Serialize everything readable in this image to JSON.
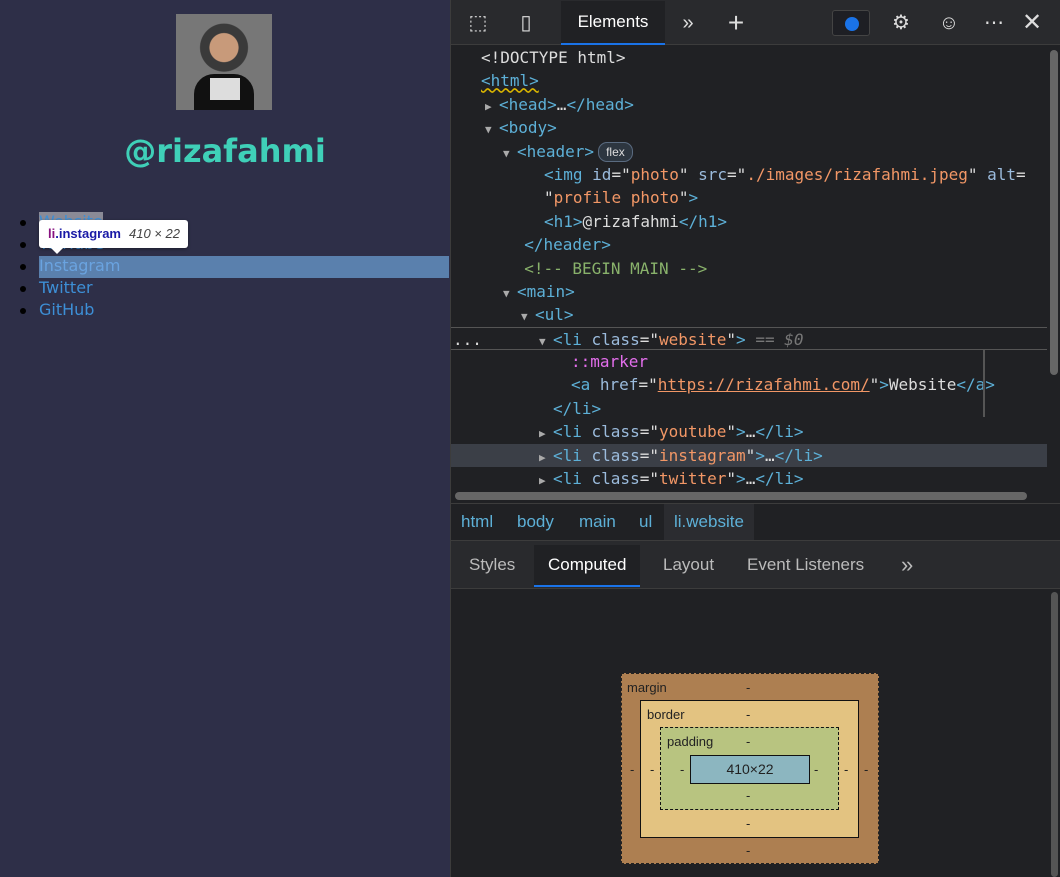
{
  "page": {
    "handle": "@rizafahmi",
    "links": [
      "Website",
      "YouTube",
      "Instagram",
      "Twitter",
      "GitHub"
    ],
    "tooltip": {
      "tag": "li",
      "cls": ".instagram",
      "size": "410 × 22"
    }
  },
  "devtools": {
    "toolbar": {
      "active_tab": "Elements",
      "icons": [
        "inspect-icon",
        "device-icon",
        "more-tabs-icon",
        "add-tab-icon",
        "issues-icon",
        "settings-icon",
        "feedback-icon",
        "more-icon",
        "close-icon"
      ]
    },
    "code": [
      {
        "d": 0,
        "t": [
          [
            "<!DOCTYPE html>",
            "txt"
          ]
        ]
      },
      {
        "d": 0,
        "t": [
          [
            "<html>",
            "tag"
          ]
        ]
      },
      {
        "d": 1,
        "a": "r",
        "t": [
          [
            "<head>",
            "tag"
          ],
          [
            "…",
            "txt"
          ],
          [
            "</head>",
            "tag"
          ]
        ]
      },
      {
        "d": 1,
        "a": "d",
        "t": [
          [
            "<body>",
            "tag"
          ]
        ]
      },
      {
        "d": 2,
        "a": "d",
        "t": [
          [
            "<header>",
            "tag"
          ]
        ],
        "badge": "flex"
      },
      {
        "d": 3.5,
        "t": [
          [
            "<img ",
            "tag"
          ],
          [
            "id",
            "attr"
          ],
          [
            "=\"",
            "txt"
          ],
          [
            "photo",
            "val"
          ],
          [
            "\" ",
            "txt"
          ],
          [
            "src",
            "attr"
          ],
          [
            "=\"",
            "txt"
          ],
          [
            "./images/rizafahmi.jpeg",
            "val"
          ],
          [
            "\" ",
            "txt"
          ],
          [
            "alt",
            "attr"
          ],
          [
            "=",
            "txt"
          ]
        ]
      },
      {
        "d": 3.5,
        "t": [
          [
            "\"",
            "txt"
          ],
          [
            "profile photo",
            "val"
          ],
          [
            "\"",
            "txt"
          ],
          [
            ">",
            "tag"
          ]
        ]
      },
      {
        "d": 3.5,
        "t": [
          [
            "<h1>",
            "tag"
          ],
          [
            "@rizafahmi",
            "txt"
          ],
          [
            "</h1>",
            "tag"
          ]
        ]
      },
      {
        "d": 2.4,
        "t": [
          [
            "</header>",
            "tag"
          ]
        ]
      },
      {
        "d": 2.4,
        "t": [
          [
            "<!-- BEGIN MAIN -->",
            "cm"
          ]
        ]
      },
      {
        "d": 2,
        "a": "d",
        "t": [
          [
            "<main>",
            "tag"
          ]
        ]
      },
      {
        "d": 3,
        "a": "d",
        "t": [
          [
            "<ul>",
            "tag"
          ]
        ]
      },
      {
        "d": 4,
        "a": "d",
        "sel": true,
        "t": [
          [
            "<li ",
            "tag"
          ],
          [
            "class",
            "attr"
          ],
          [
            "=\"",
            "txt"
          ],
          [
            "website",
            "val"
          ],
          [
            "\"",
            "txt"
          ],
          [
            ">",
            "tag"
          ],
          [
            " == ",
            "dim"
          ],
          [
            "$0",
            "dim"
          ]
        ]
      },
      {
        "d": 5,
        "t": [
          [
            "::marker",
            "ps"
          ]
        ]
      },
      {
        "d": 5,
        "t": [
          [
            "<a ",
            "tag"
          ],
          [
            "href",
            "attr"
          ],
          [
            "=\"",
            "txt"
          ],
          [
            "https://rizafahmi.com/",
            "lnk"
          ],
          [
            "\"",
            "txt"
          ],
          [
            ">",
            "tag"
          ],
          [
            "Website",
            "txt"
          ],
          [
            "</a>",
            "tag"
          ]
        ]
      },
      {
        "d": 4.0,
        "t": [
          [
            "</li>",
            "tag"
          ]
        ]
      },
      {
        "d": 4,
        "a": "r",
        "t": [
          [
            "<li ",
            "tag"
          ],
          [
            "class",
            "attr"
          ],
          [
            "=\"",
            "txt"
          ],
          [
            "youtube",
            "val"
          ],
          [
            "\"",
            "txt"
          ],
          [
            ">",
            "tag"
          ],
          [
            "…",
            "txt"
          ],
          [
            "</li>",
            "tag"
          ]
        ]
      },
      {
        "d": 4,
        "a": "r",
        "hov": true,
        "t": [
          [
            "<li ",
            "tag"
          ],
          [
            "class",
            "attr"
          ],
          [
            "=\"",
            "txt"
          ],
          [
            "instagram",
            "val"
          ],
          [
            "\"",
            "txt"
          ],
          [
            ">",
            "tag"
          ],
          [
            "…",
            "txt"
          ],
          [
            "</li>",
            "tag"
          ]
        ]
      },
      {
        "d": 4,
        "a": "r",
        "t": [
          [
            "<li ",
            "tag"
          ],
          [
            "class",
            "attr"
          ],
          [
            "=\"",
            "txt"
          ],
          [
            "twitter",
            "val"
          ],
          [
            "\"",
            "txt"
          ],
          [
            ">",
            "tag"
          ],
          [
            "…",
            "txt"
          ],
          [
            "</li>",
            "tag"
          ]
        ]
      }
    ],
    "ellipsis": "...",
    "breadcrumbs": [
      "html",
      "body",
      "main",
      "ul",
      "li.website"
    ],
    "panel_tabs": [
      "Styles",
      "Computed",
      "Layout",
      "Event Listeners"
    ],
    "active_panel_tab": "Computed",
    "box_model": {
      "margin": "margin",
      "border": "border",
      "padding": "padding",
      "content": "410×22",
      "dash": "-",
      "colors": {
        "margin": "#ad7f51",
        "border": "#e3c381",
        "padding": "#b8c480",
        "content": "#8cb6c0"
      }
    }
  }
}
